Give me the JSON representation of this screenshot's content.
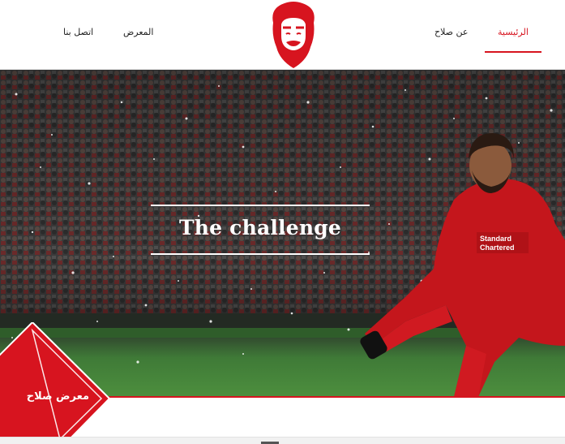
{
  "nav": {
    "home": "الرئيسية",
    "about": "عن صلاح",
    "gallery": "المعرض",
    "contact": "اتصل بنا"
  },
  "hero": {
    "title": "The challenge",
    "jersey_text": "Standard Chartered"
  },
  "badge": {
    "label": "معرض صلاح"
  },
  "colors": {
    "accent": "#d7141f",
    "header_bg": "#ffffff",
    "pitch": "#4d8f3e"
  },
  "icons": {
    "logo": "salah-face-logo"
  }
}
